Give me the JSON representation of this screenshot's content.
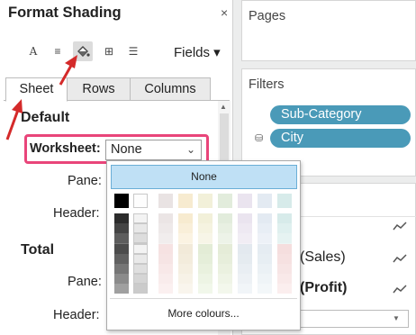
{
  "format_pane": {
    "title": "Format Shading",
    "close_glyph": "×",
    "toolbar": {
      "font_glyph": "A",
      "align_glyph": "≡",
      "shading_glyph": "◈",
      "borders_glyph": "⊞",
      "lines_glyph": "☰",
      "fields_label": "Fields ▾"
    },
    "tabs": [
      "Sheet",
      "Rows",
      "Columns"
    ],
    "default_section": {
      "title": "Default",
      "worksheet_label": "Worksheet:",
      "worksheet_value": "None",
      "pane_label": "Pane:",
      "header_label": "Header:"
    },
    "total_section": {
      "title": "Total",
      "pane_label": "Pane:",
      "header_label": "Header:"
    }
  },
  "colour_popup": {
    "none_label": "None",
    "more_label": "More colours...",
    "top_palette": [
      [
        "#000000",
        "#fdfdfd",
        "#e9e3e3",
        "#f7ebd0",
        "#f2f0d9",
        "#e2ecdc",
        "#eae4ef",
        "#e3eaf2",
        "#d7ebea",
        "#f5e8d3"
      ],
      [
        "#2c2c2c",
        "#f3f3f3",
        "#ebe5e5",
        "#f7ebd0",
        "#f2f0d9",
        "#e2ecdc",
        "#eae4ef",
        "#e3eaf2",
        "#d7ebea",
        "#f5e8d3"
      ],
      [
        "#444444",
        "#e8e8e8",
        "#eee9e9",
        "#f9efd9",
        "#f5f3e0",
        "#e8f0e2",
        "#eee9f2",
        "#e8eef5",
        "#dff0ef",
        "#f7eddd"
      ],
      [
        "#5d5d5d",
        "#dddddd",
        "#f1eded",
        "#fbf3e2",
        "#f7f5e7",
        "#edf3e8",
        "#f1edf4",
        "#edf1f7",
        "#e6f3f2",
        "#f9f1e5"
      ],
      [
        "#767676",
        "#d2d2d2",
        "#f4f1f1",
        "#fcf6ea",
        "#f9f8ee",
        "#f2f6ee",
        "#f4f1f7",
        "#f2f5fa",
        "#edf6f5",
        "#fbf5ec"
      ],
      [
        "#8f8f8f",
        "#c7c7c7",
        "#f7f5f5",
        "#fdf9f2",
        "#fbfaf4",
        "#f7f9f4",
        "#f7f5f9",
        "#f7f9fc",
        "#f4f9f8",
        "#fcf8f3"
      ]
    ],
    "bottom_palette": [
      [
        "#4c4c4c",
        "#f3f3f3",
        "#f6e2e2",
        "#f2ead9",
        "#e3ecd6",
        "#e5ecd8",
        "#e3e9ef",
        "#e5ecf2",
        "#f5dede",
        "#eae2d6"
      ],
      [
        "#616161",
        "#e9e9e9",
        "#f6e4e4",
        "#f3ecdc",
        "#e5eed9",
        "#e7eedb",
        "#e5ebf0",
        "#e7eef3",
        "#f6e1e1",
        "#ece4d9"
      ],
      [
        "#767676",
        "#dfdfdf",
        "#f8e8e8",
        "#f5efe1",
        "#e9f1de",
        "#ebf1e0",
        "#e9eef3",
        "#ebf1f5",
        "#f7e5e5",
        "#efe8de"
      ],
      [
        "#8b8b8b",
        "#d5d5d5",
        "#f9ecec",
        "#f7f2e7",
        "#edf4e4",
        "#eff4e6",
        "#edf1f5",
        "#eff4f7",
        "#f9e9e9",
        "#f2ece4"
      ],
      [
        "#a0a0a0",
        "#cbcbcb",
        "#fbf0f0",
        "#f9f5ed",
        "#f1f7ea",
        "#f3f7ec",
        "#f1f5f8",
        "#f3f7f9",
        "#fbeeee",
        "#f5f0ea"
      ]
    ]
  },
  "right_panel": {
    "pages_title": "Pages",
    "filters_title": "Filters",
    "filter_pills": [
      "Sub-Category",
      "City"
    ],
    "marks_rows": [
      "(Sales)",
      "(Profit)"
    ]
  },
  "colors": {
    "pill_blue": "#4a9ab8",
    "highlight_pink": "#e9457a",
    "arrow_red": "#d42a2a",
    "selection_blue": "#bfe0f5"
  }
}
